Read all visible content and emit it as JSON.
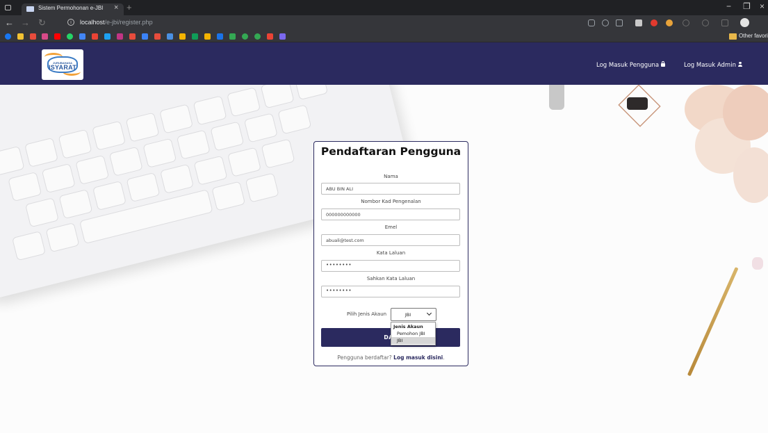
{
  "browser": {
    "tab_title": "Sistem Permohonan e-JBI",
    "tab_close": "×",
    "new_tab": "+",
    "url_host": "localhost",
    "url_path": "/e-jbi/register.php",
    "other_favorites": "Other favorites",
    "window_controls": [
      "−",
      "❐",
      "×"
    ]
  },
  "navbar": {
    "logo_small": "JURUBAHASA",
    "logo_big": "ISYARAT",
    "user_login": "Log Masuk Pengguna",
    "admin_login": "Log Masuk Admin"
  },
  "form": {
    "title": "Pendaftaran Pengguna",
    "name_label": "Nama",
    "name_value": "ABU BIN ALI",
    "ic_label": "Nombor Kad Pengenalan",
    "ic_value": "000000000000",
    "email_label": "Emel",
    "email_value": "abuali@test.com",
    "password_label": "Kata Laluan",
    "password_value": "••••••••",
    "confirm_label": "Sahkan Kata Laluan",
    "confirm_value": "••••••••",
    "account_type_label": "Pilih Jenis Akaun",
    "account_type_selected": "JBI",
    "account_type_options": [
      "Jenis Akaun",
      "Pemohon JBI",
      "JBI"
    ],
    "submit_label_visible": "DAF",
    "footer_text": "Pengguna berdaftar?",
    "footer_link": "Log masuk disini",
    "footer_period": "."
  },
  "colors": {
    "navbar_bg": "#2b2a5f",
    "accent": "#2b2a5f",
    "logo_orange": "#f2a23a",
    "logo_blue": "#3b7bc4"
  }
}
